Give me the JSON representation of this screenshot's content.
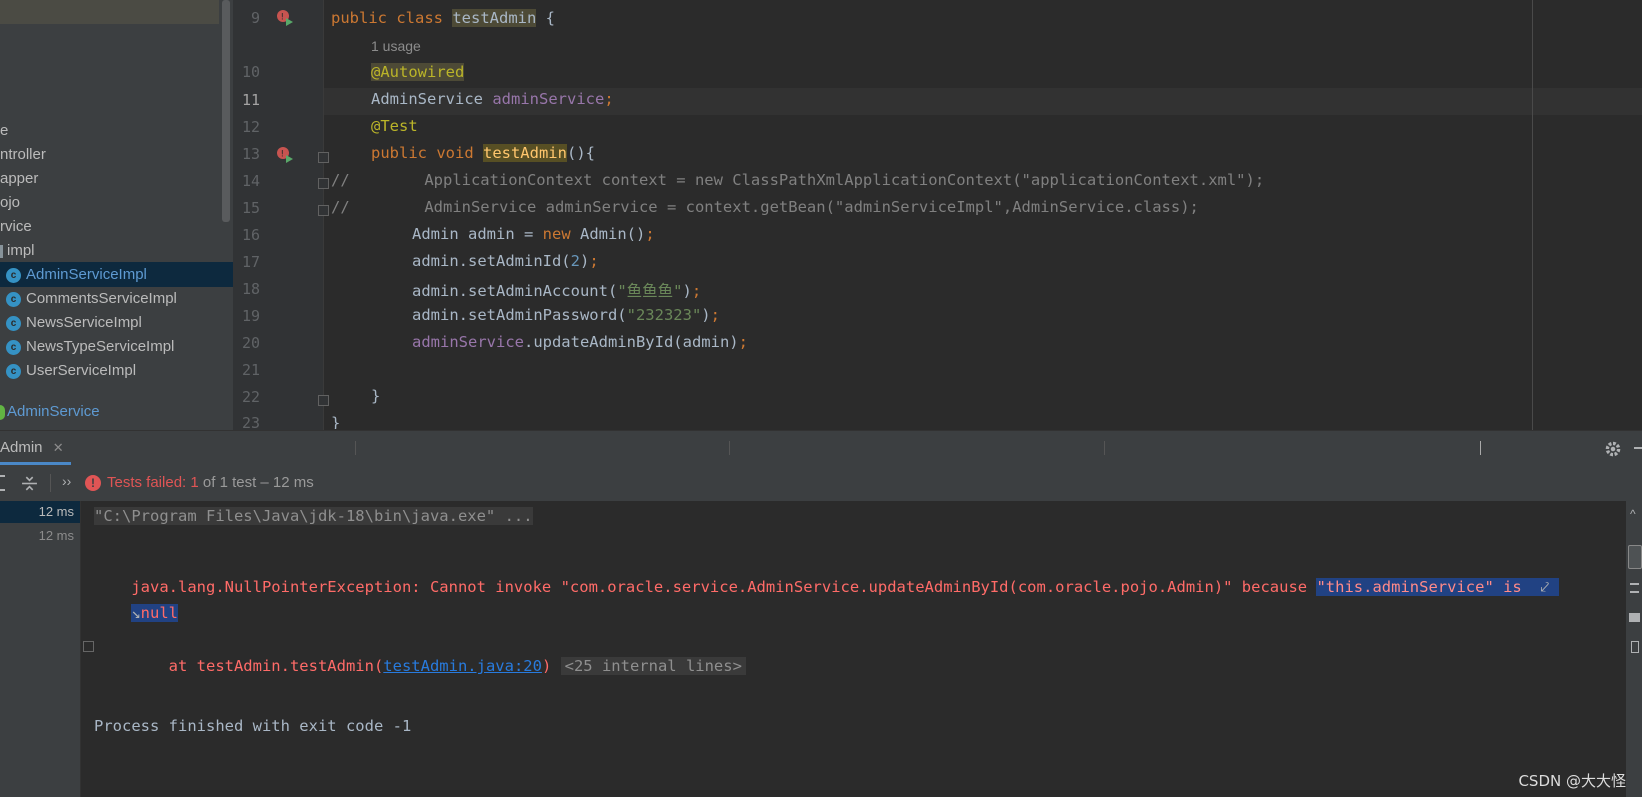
{
  "project_tree": {
    "items": [
      {
        "label": "e",
        "icon": ""
      },
      {
        "label": "ntroller",
        "icon": ""
      },
      {
        "label": "apper",
        "icon": ""
      },
      {
        "label": "ojo",
        "icon": ""
      },
      {
        "label": "rvice",
        "icon": ""
      },
      {
        "label": "impl",
        "icon": ""
      },
      {
        "label": "AdminServiceImpl",
        "icon": "class-icon",
        "icon_letter": "c",
        "selected": true
      },
      {
        "label": "CommentsServiceImpl",
        "icon": "class-icon",
        "icon_letter": "c"
      },
      {
        "label": "NewsServiceImpl",
        "icon": "class-icon",
        "icon_letter": "c"
      },
      {
        "label": "NewsTypeServiceImpl",
        "icon": "class-icon",
        "icon_letter": "c"
      },
      {
        "label": "UserServiceImpl",
        "icon": "class-icon",
        "icon_letter": "c"
      },
      {
        "label": "AdminService",
        "icon": "interface-icon"
      }
    ]
  },
  "editor": {
    "line_numbers": [
      "9",
      "10",
      "11",
      "12",
      "13",
      "14",
      "15",
      "16",
      "17",
      "18",
      "19",
      "20",
      "21",
      "22",
      "23"
    ],
    "usage_hint": "1 usage",
    "code": {
      "l9": {
        "kw": "public class ",
        "name": "testAdmin",
        "rest": " {"
      },
      "l10": "@Autowired",
      "l11": {
        "type": "AdminService ",
        "field": "adminService",
        "semi": ";"
      },
      "l12": "@Test",
      "l13": {
        "kw": "public void ",
        "name": "testAdmin",
        "rest": "(){"
      },
      "l14": "//        ApplicationContext context = new ClassPathXmlApplicationContext(\"applicationContext.xml\");",
      "l15": "//        AdminService adminService = context.getBean(\"adminServiceImpl\",AdminService.class);",
      "l16": {
        "a": "Admin admin = ",
        "kw": "new",
        "b": " Admin()",
        "semi": ";"
      },
      "l17": {
        "a": "admin.setAdminId(",
        "num": "2",
        "b": ")",
        "semi": ";"
      },
      "l18": {
        "a": "admin.setAdminAccount(",
        "str": "\"鱼鱼鱼\"",
        "b": ")",
        "semi": ";"
      },
      "l19": {
        "a": "admin.setAdminPassword(",
        "str": "\"232323\"",
        "b": ")",
        "semi": ";"
      },
      "l20": {
        "field": "adminService",
        "a": ".updateAdminById(admin)",
        "semi": ";"
      },
      "l22": "}",
      "l23": "}"
    }
  },
  "run_window": {
    "tab_label": "Admin",
    "status_prefix": "Tests failed: ",
    "status_count": "1",
    "status_suffix": " of 1 test – 12 ms",
    "test_times": [
      "12 ms",
      "12 ms"
    ],
    "console": {
      "cmd": "\"C:\\Program Files\\Java\\jdk-18\\bin\\java.exe\" ...",
      "error_main": "java.lang.NullPointerException: Cannot invoke \"com.oracle.service.AdminService.updateAdminById(com.oracle.pojo.Admin)\" because ",
      "error_selected": "\"this.adminService\" is ",
      "error_null": "null",
      "at_prefix": "    at testAdmin.testAdmin(",
      "at_link": "testAdmin.java:20",
      "at_suffix": ")",
      "internal_lines": "<25 internal lines>",
      "process_finished": "Process finished with exit code -1"
    }
  },
  "watermark": "CSDN @大大怪",
  "colors": {
    "keyword": "#cc7832",
    "annotation": "#bbb529",
    "field": "#9876aa",
    "number": "#6897bb",
    "string": "#6a8759",
    "error": "#ff6b68",
    "link": "#287bde"
  }
}
